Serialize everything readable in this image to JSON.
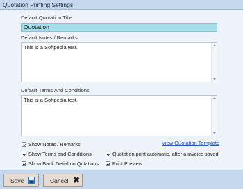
{
  "window": {
    "title": "Quotation Printing Settings"
  },
  "form": {
    "default_title_label": "Default Quotation Title",
    "default_title_value": "Quotation",
    "notes_label": "Default Notes / Remarks",
    "notes_value": "This is a Softpedia test.",
    "terms_label": "Default Terms And Conditions",
    "terms_value": "This is a Softpedia test."
  },
  "options": {
    "view_template_link": "View Quotation Template",
    "show_notes": {
      "label": "Show Notes / Remarks",
      "checked": true
    },
    "show_terms": {
      "label": "Show Terms and Conditions",
      "checked": true
    },
    "print_auto": {
      "label": "Quotation print automatic, after a invoice saved",
      "checked": true
    },
    "show_bank": {
      "label": "Show Bank Detial on Qutations",
      "checked": true
    },
    "print_preview": {
      "label": "Print Preview",
      "checked": true
    }
  },
  "footer": {
    "save_label": "Save",
    "cancel_label": "Cancel"
  },
  "colors": {
    "titlebar": "#c5d8ee",
    "panel": "#eef3f9",
    "title_input_bg": "#a9dbe8",
    "link": "#2a57b8"
  },
  "icons": {
    "save": "floppy-disk-icon",
    "cancel": "close-x-icon"
  }
}
